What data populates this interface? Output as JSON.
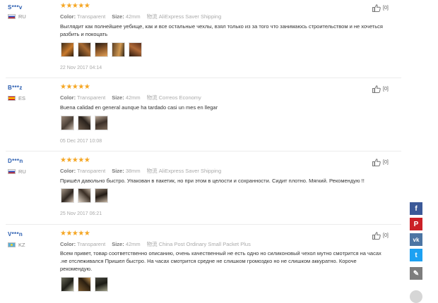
{
  "labels": {
    "color": "Color:",
    "size": "Size:",
    "shipping": "物流"
  },
  "reviews": [
    {
      "user": "S***v",
      "country": "RU",
      "stars": "★★★★★",
      "color": "Transparent",
      "size": "42mm",
      "shipping": "AliExpress Saver Shipping",
      "text": "Выглядит как полнейшее уебище, как и все остальные чехлы, взял только из за того что занимаюсь строительством и не хочеться разбить и покоцать",
      "date": "22 Nov 2017 04:14",
      "helpful": "[0]"
    },
    {
      "user": "B***z",
      "country": "ES",
      "stars": "★★★★★",
      "color": "Transparent",
      "size": "42mm",
      "shipping": "Correos Economy",
      "text": "Buena calidad en general aunque ha tardado casi un mes en llegar",
      "date": "05 Dec 2017 10:08",
      "helpful": "[0]"
    },
    {
      "user": "D***n",
      "country": "RU",
      "stars": "★★★★★",
      "color": "Transparent",
      "size": "38mm",
      "shipping": "AliExpress Saver Shipping",
      "text": "Пришёл давольно быстро. Упакован в пакетик, но при этом в целости и сохранности. Сидит плотно. Мягкий. Рекомендую !!",
      "date": "25 Nov 2017 06:21",
      "helpful": "[0]"
    },
    {
      "user": "V***n",
      "country": "KZ",
      "stars": "★★★★★",
      "color": "Transparent",
      "size": "42mm",
      "shipping": "China Post Ordinary Small Packet Plus",
      "text": "Всем привет, товар соответственно описанию, очень качественный не есть одно но силиконовый чехол мутно смотрится на часах .не отслеживался Пришел быстро. На часах смотрится средне не слишком громоздко но не слишком аккуратно. Короче рекомендую.",
      "date": "",
      "helpful": "[0]"
    }
  ],
  "share": {
    "facebook": "f",
    "pinterest": "P",
    "vk": "vk",
    "twitter": "t",
    "edit": "✎"
  },
  "icons": {
    "facebook": "facebook-icon",
    "pinterest": "pinterest-icon",
    "vk": "vk-icon",
    "twitter": "twitter-icon",
    "edit": "pencil-icon",
    "helpful": "thumbs-up-icon"
  },
  "colors": {
    "stars": "#f5a623",
    "username": "#2a5db0",
    "facebook": "#3b5998",
    "pinterest": "#cb2027",
    "vk": "#4c75a3",
    "twitter": "#1da1f2"
  }
}
